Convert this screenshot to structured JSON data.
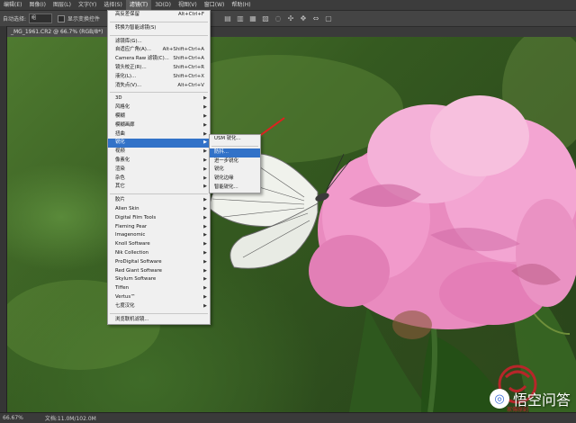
{
  "menubar": {
    "items": [
      "编辑(E)",
      "图像(I)",
      "图层(L)",
      "文字(Y)",
      "选择(S)",
      "滤镜(T)",
      "3D(D)",
      "视图(V)",
      "窗口(W)",
      "帮助(H)"
    ],
    "active_index": 5
  },
  "options_bar": {
    "auto_select_label": "自动选择:",
    "auto_select_value": "组",
    "show_transform_label": "显示变换控件"
  },
  "document": {
    "tab_title": "_MG_1961.CR2 @ 66.7% (RGB/8*)",
    "zoom": "66.67%",
    "doc_info": "文档:11.0M/102.0M"
  },
  "filter_menu": {
    "sections": [
      [
        {
          "label": "高反差保留",
          "shortcut": "Alt+Ctrl+F"
        }
      ],
      [
        {
          "label": "转换为智能滤镜(S)",
          "shortcut": ""
        }
      ],
      [
        {
          "label": "滤镜库(G)...",
          "shortcut": ""
        },
        {
          "label": "自适应广角(A)...",
          "shortcut": "Alt+Shift+Ctrl+A"
        },
        {
          "label": "Camera Raw 滤镜(C)...",
          "shortcut": "Shift+Ctrl+A"
        },
        {
          "label": "镜头校正(R)...",
          "shortcut": "Shift+Ctrl+R"
        },
        {
          "label": "液化(L)...",
          "shortcut": "Shift+Ctrl+X"
        },
        {
          "label": "消失点(V)...",
          "shortcut": "Alt+Ctrl+V"
        }
      ],
      [
        {
          "label": "3D",
          "submenu": true
        },
        {
          "label": "风格化",
          "submenu": true
        },
        {
          "label": "模糊",
          "submenu": true
        },
        {
          "label": "模糊画廊",
          "submenu": true
        },
        {
          "label": "扭曲",
          "submenu": true
        },
        {
          "label": "锐化",
          "submenu": true,
          "highlighted": true
        },
        {
          "label": "视频",
          "submenu": true
        },
        {
          "label": "像素化",
          "submenu": true
        },
        {
          "label": "渲染",
          "submenu": true
        },
        {
          "label": "杂色",
          "submenu": true
        },
        {
          "label": "其它",
          "submenu": true
        }
      ],
      [
        {
          "label": "胶片",
          "submenu": true
        },
        {
          "label": "Alien Skin",
          "submenu": true
        },
        {
          "label": "Digital Film Tools",
          "submenu": true
        },
        {
          "label": "Fleming Pear",
          "submenu": true
        },
        {
          "label": "Imagenomic",
          "submenu": true
        },
        {
          "label": "Knoll Software",
          "submenu": true
        },
        {
          "label": "Nik Collection",
          "submenu": true
        },
        {
          "label": "ProDigital Software",
          "submenu": true
        },
        {
          "label": "Red Giant Software",
          "submenu": true
        },
        {
          "label": "Skylum Software",
          "submenu": true
        },
        {
          "label": "Tiffen",
          "submenu": true
        },
        {
          "label": "Vertus™",
          "submenu": true
        },
        {
          "label": "七度汉化",
          "submenu": true
        }
      ],
      [
        {
          "label": "浏览联机滤镜...",
          "shortcut": ""
        }
      ]
    ]
  },
  "sharpen_submenu": {
    "items": [
      {
        "label": "USM 锐化..."
      },
      {
        "label": "防抖...",
        "highlighted": true
      },
      {
        "label": "进一步锐化"
      },
      {
        "label": "锐化"
      },
      {
        "label": "锐化边缘"
      },
      {
        "label": "智能锐化..."
      }
    ]
  },
  "watermark": {
    "logo_glyph": "◎",
    "text": "悟空问答"
  },
  "colors": {
    "menu_highlight": "#3272c8",
    "annotation_arrow": "#e02020",
    "flower_pink": "#ec8ec4",
    "seal_red": "#b8262a"
  }
}
